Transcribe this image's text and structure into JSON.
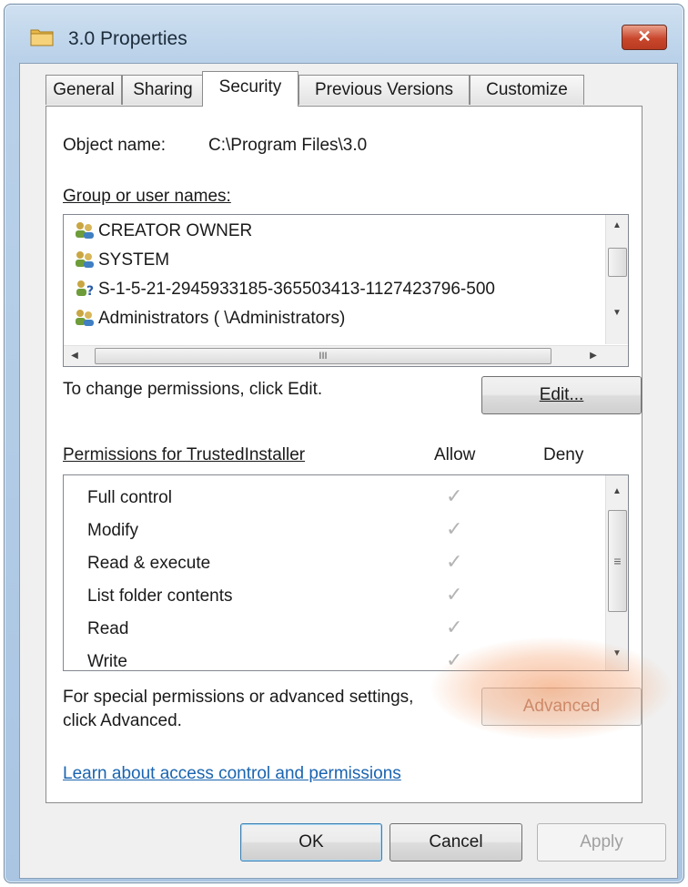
{
  "window": {
    "title": "3.0 Properties",
    "close_label": "✕"
  },
  "tabs": [
    {
      "label": "General"
    },
    {
      "label": "Sharing"
    },
    {
      "label": "Security"
    },
    {
      "label": "Previous Versions"
    },
    {
      "label": "Customize"
    }
  ],
  "security": {
    "object_name_label": "Object name:",
    "object_name_value": "C:\\Program Files\\3.0",
    "group_label": "Group or user names:",
    "users": [
      {
        "name": "CREATOR OWNER",
        "icon": "user-group-icon"
      },
      {
        "name": "SYSTEM",
        "icon": "user-group-icon"
      },
      {
        "name": "S-1-5-21-2945933185-365503413-1127423796-500",
        "icon": "unknown-user-icon"
      },
      {
        "name": "Administrators (               \\Administrators)",
        "icon": "user-group-icon"
      }
    ],
    "change_text": "To change permissions, click Edit.",
    "edit_label": "Edit...",
    "permissions_label": "Permissions for TrustedInstaller",
    "allow_header": "Allow",
    "deny_header": "Deny",
    "permissions": [
      {
        "name": "Full control",
        "allow": true,
        "deny": false
      },
      {
        "name": "Modify",
        "allow": true,
        "deny": false
      },
      {
        "name": "Read & execute",
        "allow": true,
        "deny": false
      },
      {
        "name": "List folder contents",
        "allow": true,
        "deny": false
      },
      {
        "name": "Read",
        "allow": true,
        "deny": false
      },
      {
        "name": "Write",
        "allow": true,
        "deny": false
      }
    ],
    "special_text_1": "For special permissions or advanced settings,",
    "special_text_2": "click Advanced.",
    "advanced_label": "Advanced",
    "learn_link": "Learn about access control and permissions",
    "hscroll_grip": "III",
    "vscroll_grip": "≡"
  },
  "buttons": {
    "ok": "OK",
    "cancel": "Cancel",
    "apply": "Apply"
  },
  "colors": {
    "link": "#1a64b0",
    "highlight": "#f08c50",
    "checkmark": "#b4b4b4"
  }
}
